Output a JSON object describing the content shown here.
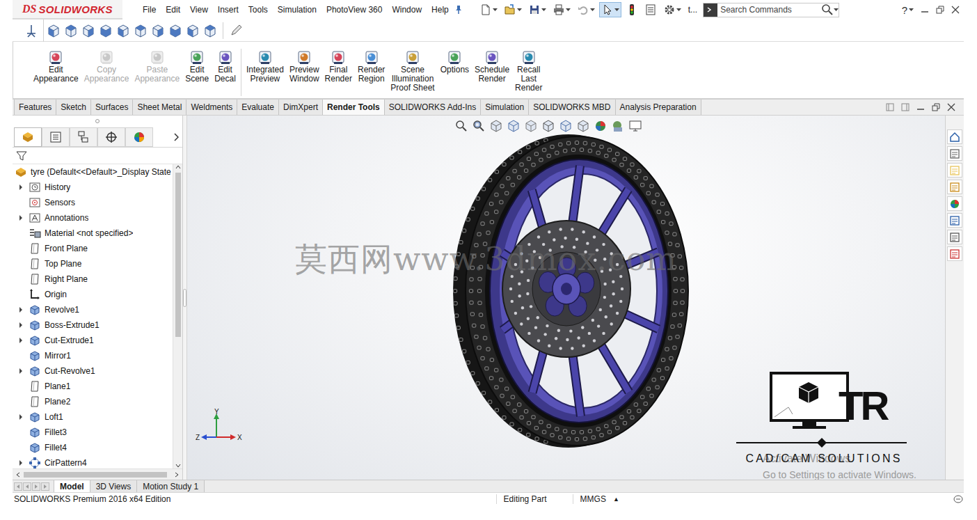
{
  "app": {
    "logo_mark": "DS",
    "logo_name": "SOLIDWORKS"
  },
  "menu": [
    "File",
    "Edit",
    "View",
    "Insert",
    "Tools",
    "Simulation",
    "PhotoView 360",
    "Window",
    "Help"
  ],
  "document_short": "t...",
  "search": {
    "placeholder": "Search Commands"
  },
  "help": "?",
  "ribbon": {
    "groups": [
      [
        {
          "lines": [
            "Edit",
            "Appearance"
          ],
          "disabled": false
        },
        {
          "lines": [
            "Copy",
            "Appearance"
          ],
          "disabled": true
        },
        {
          "lines": [
            "Paste",
            "Appearance"
          ],
          "disabled": true
        },
        {
          "lines": [
            "Edit",
            "Scene"
          ],
          "disabled": false
        },
        {
          "lines": [
            "Edit",
            "Decal"
          ],
          "disabled": false
        }
      ],
      [
        {
          "lines": [
            "Integrated",
            "Preview"
          ],
          "disabled": false
        },
        {
          "lines": [
            "Preview",
            "Window"
          ],
          "disabled": false
        },
        {
          "lines": [
            "Final",
            "Render"
          ],
          "disabled": false
        },
        {
          "lines": [
            "Render",
            "Region"
          ],
          "disabled": false
        },
        {
          "lines": [
            "Scene",
            "Illumination",
            "Proof Sheet"
          ],
          "disabled": false
        },
        {
          "lines": [
            "Options"
          ],
          "disabled": false
        },
        {
          "lines": [
            "Schedule",
            "Render"
          ],
          "disabled": false
        },
        {
          "lines": [
            "Recall",
            "Last",
            "Render"
          ],
          "disabled": false
        }
      ]
    ]
  },
  "tabs": [
    {
      "label": "Features",
      "selected": false
    },
    {
      "label": "Sketch",
      "selected": false
    },
    {
      "label": "Surfaces",
      "selected": false
    },
    {
      "label": "Sheet Metal",
      "selected": false
    },
    {
      "label": "Weldments",
      "selected": false
    },
    {
      "label": "Evaluate",
      "selected": false
    },
    {
      "label": "DimXpert",
      "selected": false
    },
    {
      "label": "Render Tools",
      "selected": true
    },
    {
      "label": "SOLIDWORKS Add-Ins",
      "selected": false
    },
    {
      "label": "Simulation",
      "selected": false
    },
    {
      "label": "SOLIDWORKS MBD",
      "selected": false
    },
    {
      "label": "Analysis Preparation",
      "selected": false
    }
  ],
  "panel_tabs": [
    {
      "kind": "feature-manager",
      "selected": true
    },
    {
      "kind": "property-manager",
      "selected": false
    },
    {
      "kind": "configuration-manager",
      "selected": false
    },
    {
      "kind": "dimxpert-manager",
      "selected": false
    },
    {
      "kind": "display-manager",
      "selected": false
    }
  ],
  "tree": {
    "root": "tyre  (Default<<Default>_Display State",
    "items": [
      {
        "label": "History",
        "kind": "history",
        "expandable": true
      },
      {
        "label": "Sensors",
        "kind": "sensors",
        "expandable": false
      },
      {
        "label": "Annotations",
        "kind": "annotations",
        "expandable": true
      },
      {
        "label": "Material <not specified>",
        "kind": "material",
        "expandable": false
      },
      {
        "label": "Front Plane",
        "kind": "plane",
        "expandable": false
      },
      {
        "label": "Top Plane",
        "kind": "plane",
        "expandable": false
      },
      {
        "label": "Right Plane",
        "kind": "plane",
        "expandable": false
      },
      {
        "label": "Origin",
        "kind": "origin",
        "expandable": false
      },
      {
        "label": "Revolve1",
        "kind": "feature",
        "expandable": true
      },
      {
        "label": "Boss-Extrude1",
        "kind": "feature",
        "expandable": true
      },
      {
        "label": "Cut-Extrude1",
        "kind": "feature",
        "expandable": true
      },
      {
        "label": "Mirror1",
        "kind": "feature",
        "expandable": false
      },
      {
        "label": "Cut-Revolve1",
        "kind": "feature",
        "expandable": true
      },
      {
        "label": "Plane1",
        "kind": "plane",
        "expandable": false
      },
      {
        "label": "Plane2",
        "kind": "plane",
        "expandable": false
      },
      {
        "label": "Loft1",
        "kind": "feature",
        "expandable": true
      },
      {
        "label": "Fillet3",
        "kind": "feature",
        "expandable": false
      },
      {
        "label": "Fillet4",
        "kind": "feature",
        "expandable": false
      },
      {
        "label": "CirPattern4",
        "kind": "pattern",
        "expandable": true
      }
    ]
  },
  "viewport": {
    "watermark": "莫西网www.3dmox.com",
    "triad": {
      "x": "X",
      "y": "Y",
      "z": "Z"
    },
    "brand": {
      "mark": "TR",
      "name": "CAD/CAM SOLUTIONS"
    },
    "activation": {
      "title": "Activate Windows",
      "subtitle": "Go to Settings to activate Windows."
    }
  },
  "bottom_tabs": [
    {
      "label": "Model",
      "selected": true
    },
    {
      "label": "3D Views",
      "selected": false
    },
    {
      "label": "Motion Study 1",
      "selected": false
    }
  ],
  "status_bar": {
    "edition": "SOLIDWORKS Premium 2016 x64 Edition",
    "mode": "Editing Part",
    "units": "MMGS",
    "units_arrow": "▲"
  }
}
